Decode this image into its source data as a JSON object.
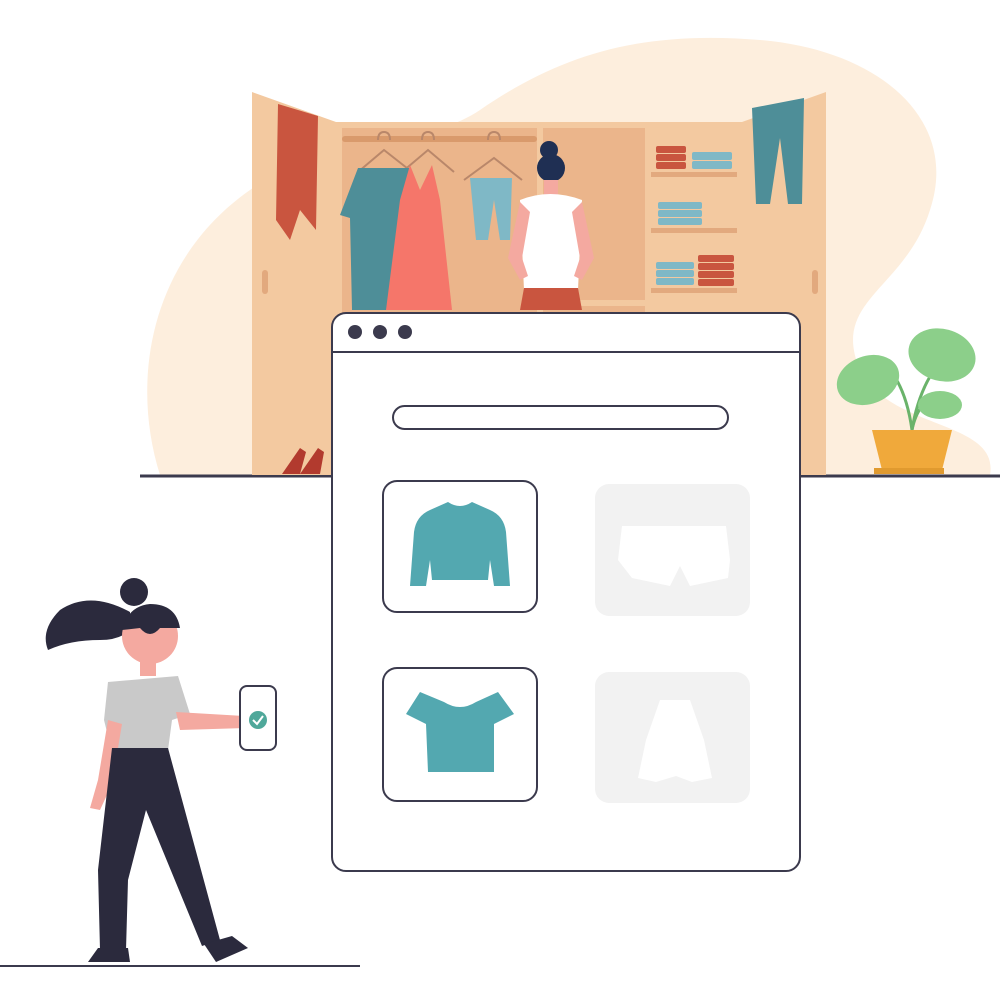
{
  "scene": {
    "description_labels": [],
    "colors": {
      "blob": "#fdeedd",
      "wardrobe_frame": "#f3c9a0",
      "wardrobe_inner": "#ebb58b",
      "wardrobe_shadow": "#e2a97e",
      "outline": "#3b3a4d",
      "teal": "#53a8b0",
      "teal_dark": "#3f8189",
      "coral": "#f26b5b",
      "rust": "#c9553f",
      "dress": "#f5766a",
      "placeholder_bg": "#f2f2f2",
      "placeholder_shape": "#ffffff",
      "skin": "#f4a9a0",
      "hair": "#2b2a3d",
      "pants": "#2b2a3d",
      "shirt_gray": "#c9c9c9",
      "pot": "#f0a93b",
      "leaf": "#8ccf8a",
      "check_green": "#4fa89a"
    }
  },
  "browser_window": {
    "dots": [
      "dot-1",
      "dot-2",
      "dot-3"
    ],
    "search_bar_value": "",
    "cards": [
      {
        "name": "card-sweater",
        "icon": "sweater-icon",
        "state": "selected"
      },
      {
        "name": "card-shorts",
        "icon": "shorts-icon",
        "state": "placeholder"
      },
      {
        "name": "card-crop-top",
        "icon": "crop-top-icon",
        "state": "selected"
      },
      {
        "name": "card-skirt",
        "icon": "skirt-icon",
        "state": "placeholder"
      }
    ]
  },
  "phone": {
    "icon": "checkmark-icon"
  }
}
